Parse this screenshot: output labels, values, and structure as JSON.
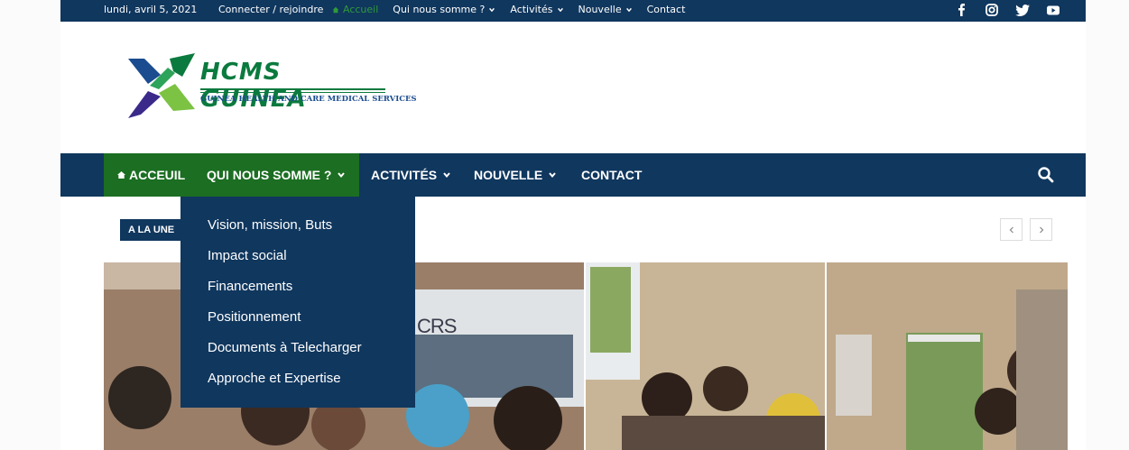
{
  "topbar": {
    "date": "lundi, avril 5, 2021",
    "login": "Connecter / rejoindre",
    "menu": [
      {
        "label": "Accueil",
        "active": true
      },
      {
        "label": "Qui nous somme ?",
        "dropdown": true
      },
      {
        "label": "Activités",
        "dropdown": true
      },
      {
        "label": "Nouvelle",
        "dropdown": true
      },
      {
        "label": "Contact"
      }
    ],
    "social": [
      "facebook-icon",
      "instagram-icon",
      "twitter-icon",
      "youtube-icon"
    ]
  },
  "logo": {
    "title": "HCMS GUINEA",
    "subtitle": "GUINEA HEALTH AND CARE MEDICAL SERVICES"
  },
  "nav": {
    "items": [
      {
        "label": "ACCEUIL"
      },
      {
        "label": "QUI NOUS SOMME ?"
      },
      {
        "label": "ACTIVITÉS"
      },
      {
        "label": "NOUVELLE"
      },
      {
        "label": "CONTACT"
      }
    ]
  },
  "dropdown": {
    "items": [
      "Vision, mission, Buts",
      "Impact social",
      "Financements",
      "Positionnement",
      "Documents à Telecharger",
      "Approche et Expertise"
    ]
  },
  "alaune": "A LA UNE",
  "banner_text": "CRS",
  "colors": {
    "navy": "#10375e",
    "green": "#1b6e22",
    "accent_green": "#2f9a3a"
  }
}
